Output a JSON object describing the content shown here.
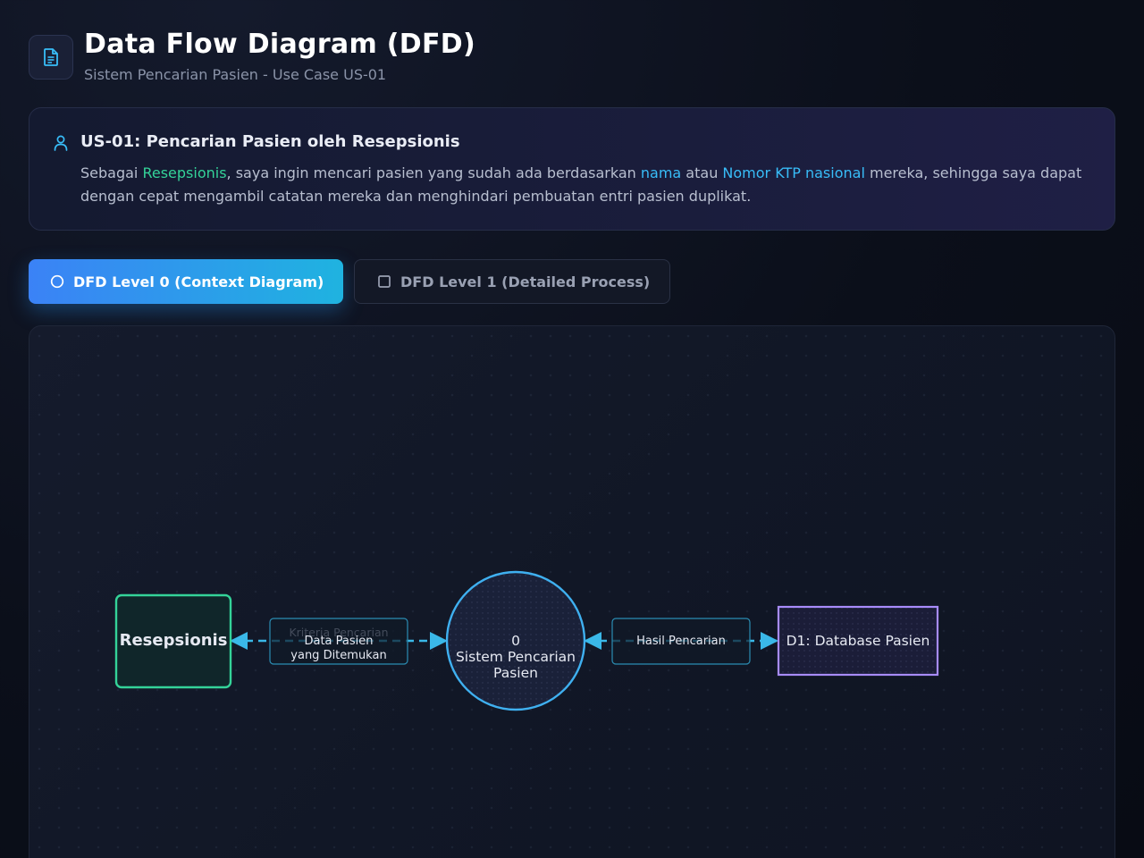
{
  "header": {
    "icon": "document-icon",
    "title": "Data Flow Diagram (DFD)",
    "subtitle": "Sistem Pencarian Pasien - Use Case US-01"
  },
  "user_story": {
    "icon": "user-icon",
    "title": "US-01: Pencarian Pasien oleh Resepsionis",
    "text_1": "Sebagai ",
    "role": "Resepsionis",
    "text_2": ", saya ingin mencari pasien yang sudah ada berdasarkan ",
    "key_1": "nama",
    "text_3": " atau ",
    "key_2": "Nomor KTP nasional",
    "text_4": " mereka, sehingga saya dapat dengan cepat mengambil catatan mereka dan menghindari pembuatan entri pasien duplikat."
  },
  "tabs": [
    {
      "label": "DFD Level 0 (Context Diagram)",
      "icon": "circle-icon",
      "active": true
    },
    {
      "label": "DFD Level 1 (Detailed Process)",
      "icon": "square-icon",
      "active": false
    }
  ],
  "diagram": {
    "entity": {
      "label": "Resepsionis"
    },
    "process": {
      "number": "0",
      "line1": "Sistem Pencarian",
      "line2": "Pasien"
    },
    "datastore": {
      "label": "D1: Database Pasien"
    },
    "flows": [
      {
        "label_line1": "Data Pasien",
        "label_line2": "yang Ditemukan",
        "hidden_label": "Kriteria Pencarian"
      },
      {
        "label_line1": "Hasil Pencarian"
      }
    ]
  },
  "colors": {
    "accent_blue": "#38bdf8",
    "entity_green": "#34d399",
    "store_purple": "#a78bfa",
    "flow_cyan": "#3ab8e8"
  }
}
